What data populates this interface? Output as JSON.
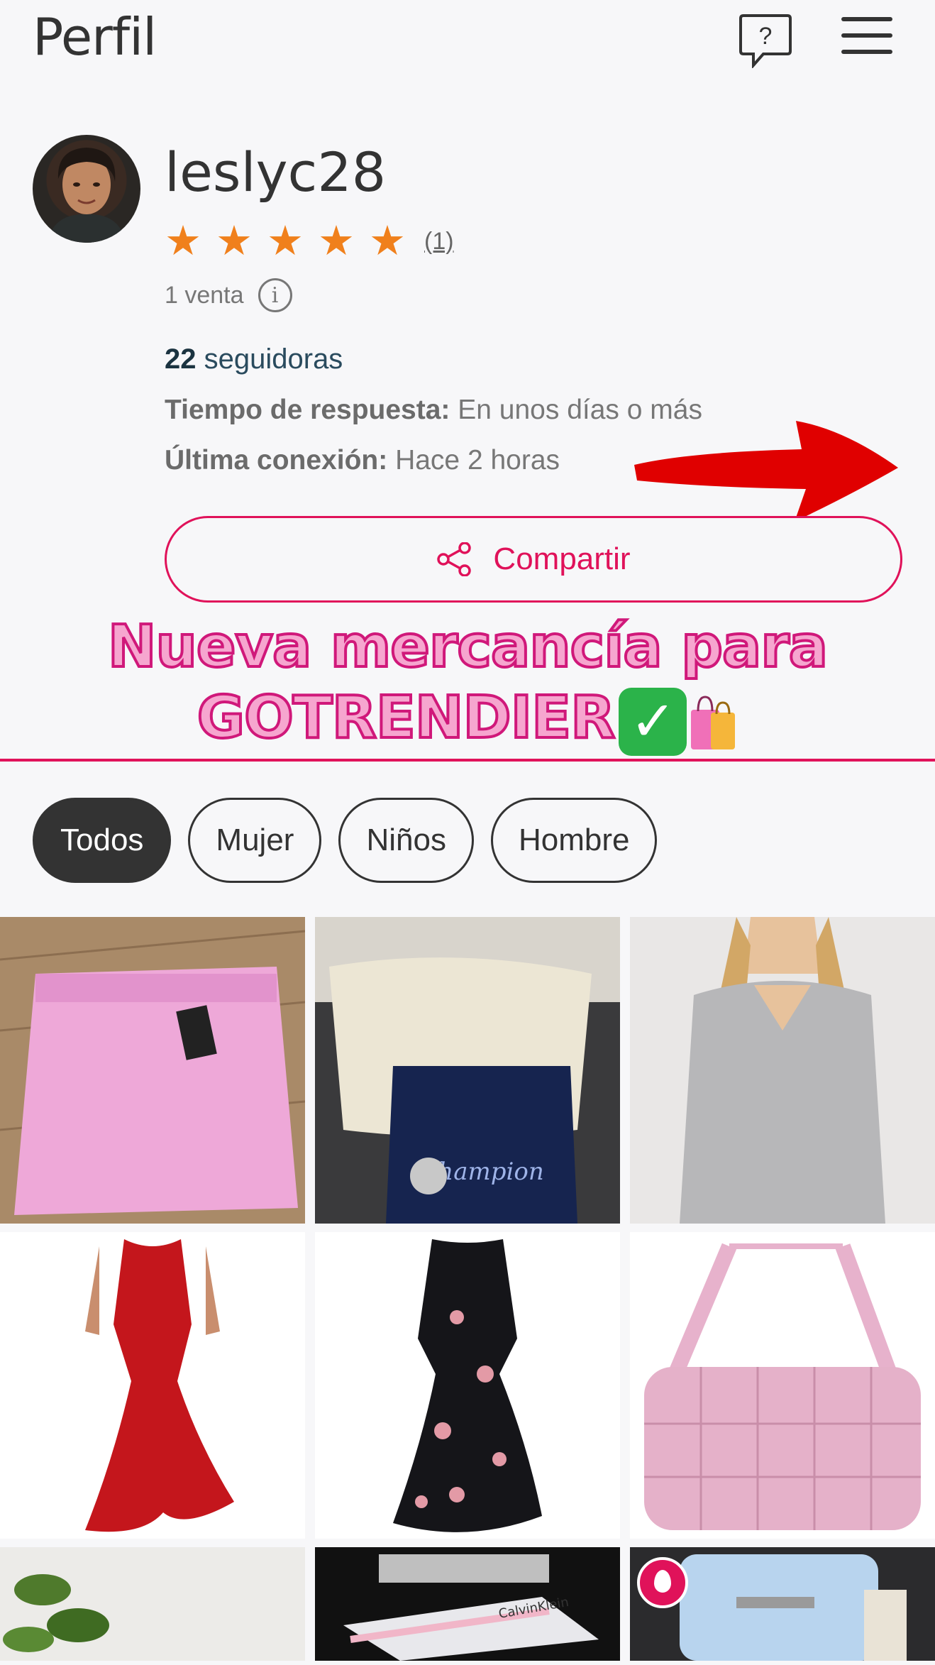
{
  "header": {
    "title": "Perfil",
    "help_icon": "question-bubble-icon",
    "menu_icon": "hamburger-menu-icon"
  },
  "profile": {
    "username": "leslyc28",
    "rating": {
      "stars": 5,
      "count_label": "(1)"
    },
    "sales_label": "1 venta",
    "followers_count": "22",
    "followers_label": "seguidoras",
    "response_time_label": "Tiempo de respuesta:",
    "response_time_value": "En unos días o más",
    "last_connection_label": "Última conexión:",
    "last_connection_value": "Hace 2 horas",
    "share_label": "Compartir"
  },
  "promo": {
    "line1": "Nueva mercancía para",
    "line2": "GOTRENDIER"
  },
  "filters": {
    "todos": "Todos",
    "mujer": "Mujer",
    "ninos": "Niños",
    "hombre": "Hombre"
  },
  "colors": {
    "accent": "#e0125a",
    "star": "#f0801c",
    "dark_chip": "#333333",
    "arrow": "#e00000"
  },
  "products": [
    {
      "image": "pink-denim-skirt"
    },
    {
      "image": "champion-bags"
    },
    {
      "image": "grey-v-neck-sweater"
    },
    {
      "image": "red-ruffle-dress"
    },
    {
      "image": "black-floral-dress"
    },
    {
      "image": "pink-quilted-bag"
    },
    {
      "image": "plant-photo"
    },
    {
      "image": "calvin-klein-underwear"
    },
    {
      "image": "light-blue-quilted-bag",
      "badge": "hot-icon"
    }
  ]
}
